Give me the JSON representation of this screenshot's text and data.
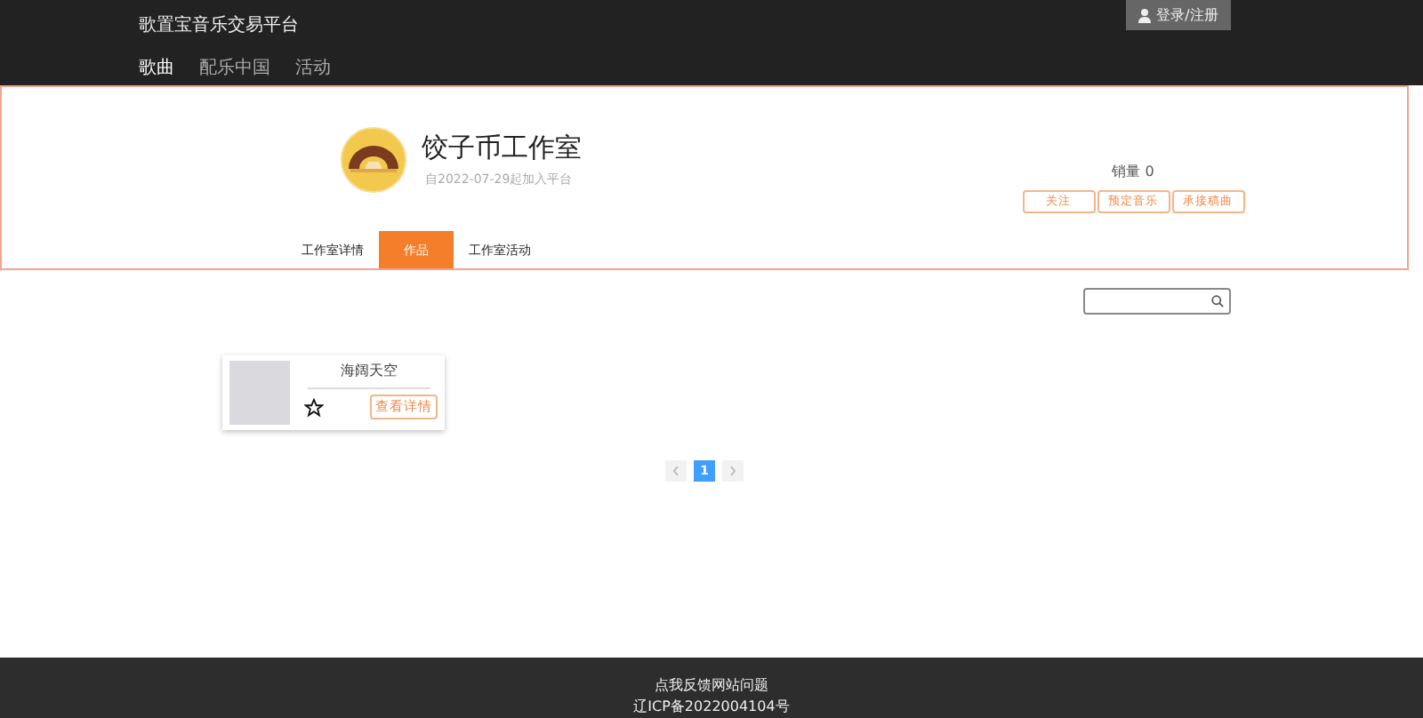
{
  "header": {
    "title": "歌置宝音乐交易平台",
    "login_button": "登录/注册",
    "nav": [
      {
        "label": "歌曲",
        "selected": true
      },
      {
        "label": "配乐中国",
        "selected": false
      },
      {
        "label": "活动",
        "selected": false
      }
    ]
  },
  "studio": {
    "name": "饺子币工作室",
    "joined": "自2022-07-29起加入平台",
    "sales": "销量 0",
    "actions": [
      "关注",
      "预定音乐",
      "承接稿曲"
    ],
    "tabs": [
      {
        "label": "工作室详情",
        "selected": false
      },
      {
        "label": "作品",
        "selected": true
      },
      {
        "label": "工作室活动",
        "selected": false
      }
    ]
  },
  "works": [
    {
      "title": "海阔天空",
      "favorited": false,
      "detail_button": "查看详情"
    }
  ],
  "pagination": {
    "pages": [
      {
        "label": "1",
        "selected": true
      }
    ]
  },
  "footer": {
    "feedback": "点我反馈网站问题",
    "icp": "辽ICP备2022004104号"
  }
}
